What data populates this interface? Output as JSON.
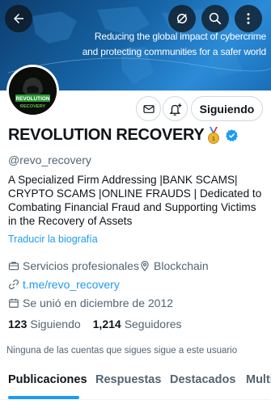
{
  "banner": {
    "line1": "Reducing the global impact of cybercrime",
    "line2": "and protecting communities for a safer world"
  },
  "profile": {
    "display_name": "REVOLUTION RECOVERY",
    "handle": "@revo_recovery",
    "bio": "A Specialized Firm Addressing |BANK SCAMS| CRYPTO SCAMS |ONLINE FRAUDS | Dedicated to Combating Financial Fraud and Supporting Victims in the Recovery of Assets",
    "translate_label": "Traducir la biografía",
    "category": "Servicios profesionales",
    "location": "Blockchain",
    "website": "t.me/revo_recovery",
    "joined": "Se unió en diciembre de 2012",
    "following_count": "123",
    "following_label": "Siguiendo",
    "followers_count": "1,214",
    "followers_label": "Seguidores",
    "no_mutuals": "Ninguna de las cuentas que sigues sigue a este usuario",
    "avatar_text_top": "REVOLUTION",
    "avatar_text_bottom": "RECOVERY"
  },
  "actions": {
    "follow_label": "Siguiendo"
  },
  "tabs": [
    {
      "label": "Publicaciones",
      "active": true
    },
    {
      "label": "Respuestas",
      "active": false
    },
    {
      "label": "Destacados",
      "active": false
    },
    {
      "label": "Multi",
      "active": false
    }
  ],
  "icons": {
    "back": "back-arrow-icon",
    "hide": "eye-slash-icon",
    "search": "search-icon",
    "more": "more-vertical-icon",
    "message": "envelope-icon",
    "notify": "bell-plus-icon",
    "medal": "medal-icon",
    "verified": "verified-badge-icon",
    "category": "briefcase-icon",
    "location": "location-pin-icon",
    "link": "link-icon",
    "calendar": "calendar-icon"
  },
  "colors": {
    "accent": "#1d9bf0",
    "text_primary": "#0f1419",
    "text_secondary": "#536471",
    "banner": "#1664a6"
  }
}
